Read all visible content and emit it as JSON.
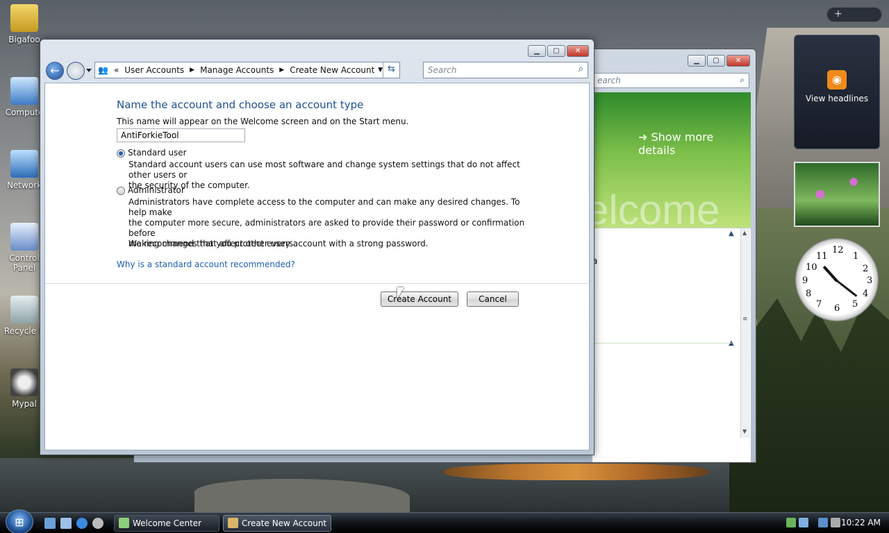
{
  "desktop": {
    "icons": [
      {
        "label": "Bigafoo"
      },
      {
        "label": "Compute"
      },
      {
        "label": "Network"
      },
      {
        "label": "Control Panel"
      },
      {
        "label": "Recycle B"
      },
      {
        "label": "Mypal"
      }
    ]
  },
  "gadgets": {
    "add_symbol": "+",
    "feed_label": "View headlines",
    "clock_numbers": [
      "12",
      "1",
      "2",
      "3",
      "4",
      "5",
      "6",
      "7",
      "8",
      "9",
      "10",
      "11"
    ]
  },
  "background_window": {
    "search_placeholder": "earch",
    "show_more": "Show more details",
    "banner_text": "elcome",
    "content_fragment": "a"
  },
  "window": {
    "breadcrumb": [
      "User Accounts",
      "Manage Accounts",
      "Create New Account"
    ],
    "breadcrumb_prefix": "«",
    "search_placeholder": "Search",
    "heading": "Name the account and choose an account type",
    "hint": "This name will appear on the Welcome screen and on the Start menu.",
    "account_name": "AntiForkieTool",
    "options": [
      {
        "label": "Standard user",
        "selected": true,
        "description_lines": [
          "Standard account users can use most software and change system settings that do not affect other users or",
          "the security of the computer."
        ]
      },
      {
        "label": "Administrator",
        "selected": false,
        "description_lines": [
          "Administrators have complete access to the computer and can make any desired changes. To help make",
          "the computer more secure, administrators are asked to provide their password or confirmation before",
          "making changes that affect other users."
        ]
      }
    ],
    "recommendation": "We recommend that you protect every account with a strong password.",
    "help_link": "Why is a standard account recommended?",
    "create_button": "Create Account",
    "cancel_button": "Cancel"
  },
  "taskbar": {
    "tasks": [
      "Welcome Center",
      "Create New Account"
    ],
    "clock": "10:22 AM"
  },
  "colors": {
    "heading": "#1e4f90",
    "link": "#1d5fb4",
    "close_button": "#c0392b"
  }
}
